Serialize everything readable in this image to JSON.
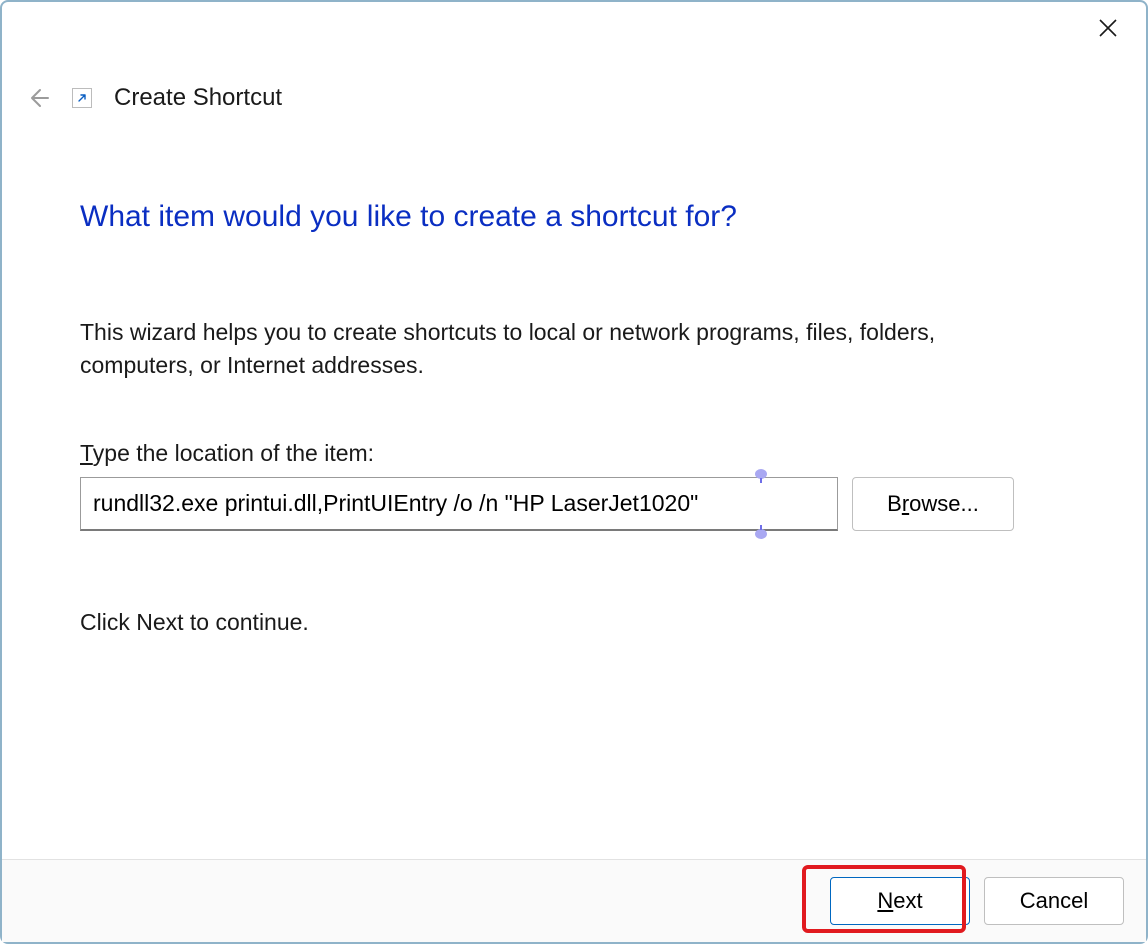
{
  "titlebar": {
    "close_aria": "Close"
  },
  "header": {
    "back_aria": "Back",
    "icon_aria": "Shortcut overlay icon",
    "wizard_title": "Create Shortcut"
  },
  "main": {
    "heading": "What item would you like to create a shortcut for?",
    "description": "This wizard helps you to create shortcuts to local or network programs, files, folders, computers, or Internet addresses.",
    "location_label_pre": "T",
    "location_label_rest": "ype the location of the item:",
    "location_value": "rundll32.exe printui.dll,PrintUIEntry /o /n \"HP LaserJet1020\" ",
    "browse_pre": "B",
    "browse_u": "r",
    "browse_post": "owse...",
    "continue_hint": "Click Next to continue."
  },
  "footer": {
    "next_u": "N",
    "next_rest": "ext",
    "cancel": "Cancel"
  },
  "colors": {
    "accent": "#0a2ec2",
    "highlight": "#e11a1f",
    "border": "#8fb3c9"
  }
}
